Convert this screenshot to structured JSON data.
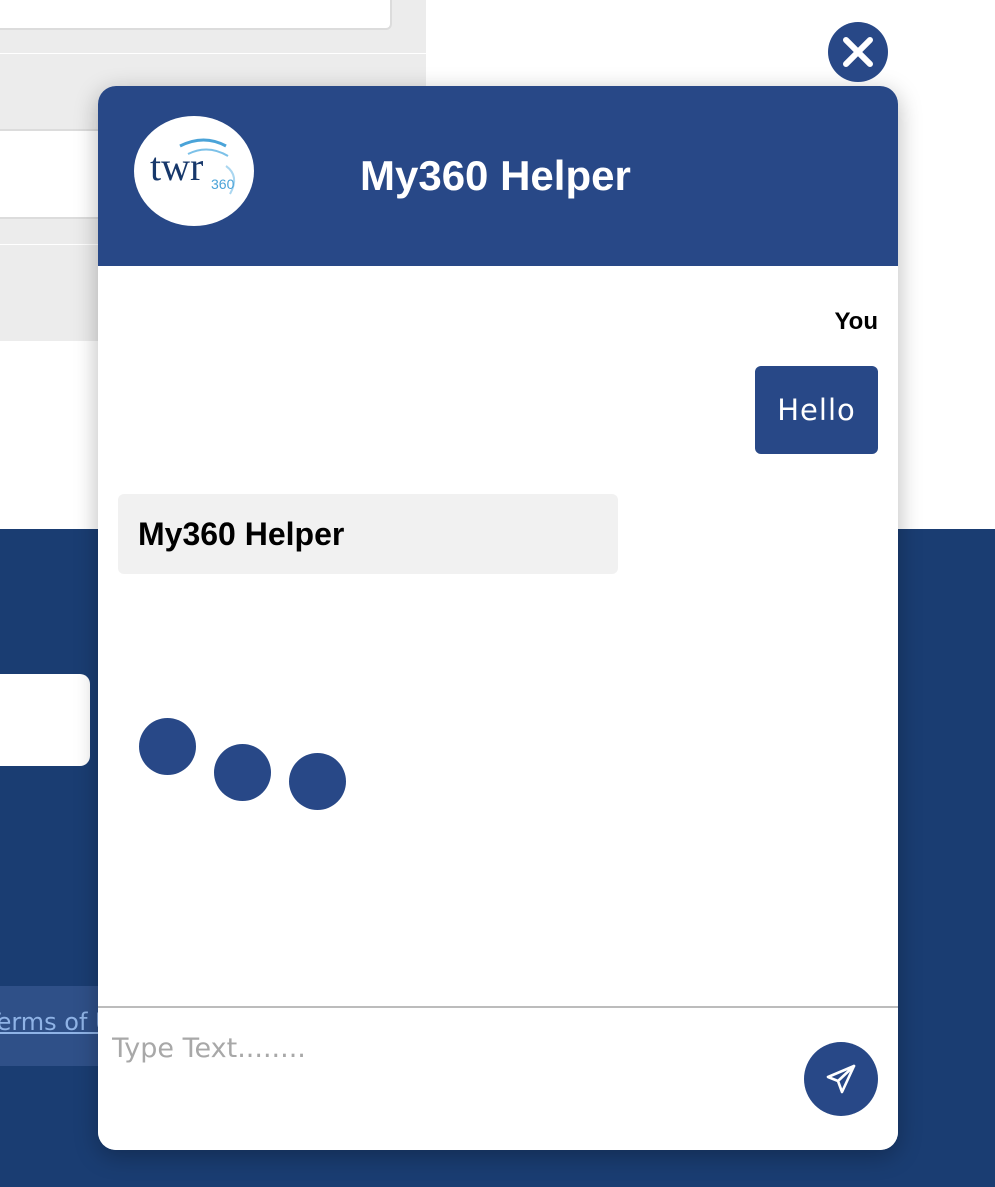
{
  "background": {
    "footer_link_text": "Terms of Use"
  },
  "close_button": {
    "icon": "close-icon"
  },
  "chat": {
    "title": "My360 Helper",
    "logo": {
      "icon": "twr360-logo",
      "brand_text": "twr",
      "brand_number": "360"
    },
    "messages": [
      {
        "sender": "You",
        "text": "Hello"
      },
      {
        "sender": "My360 Helper",
        "text": ""
      }
    ],
    "typing_indicator": {
      "dots": 3
    },
    "input": {
      "placeholder": "Type Text........",
      "value": ""
    },
    "send_button": {
      "icon": "send-icon"
    }
  },
  "colors": {
    "brand": "#284887",
    "footer": "#1a3d72",
    "bot_bubble": "#f1f1f1",
    "logo_blue": "#4aa3d8"
  }
}
